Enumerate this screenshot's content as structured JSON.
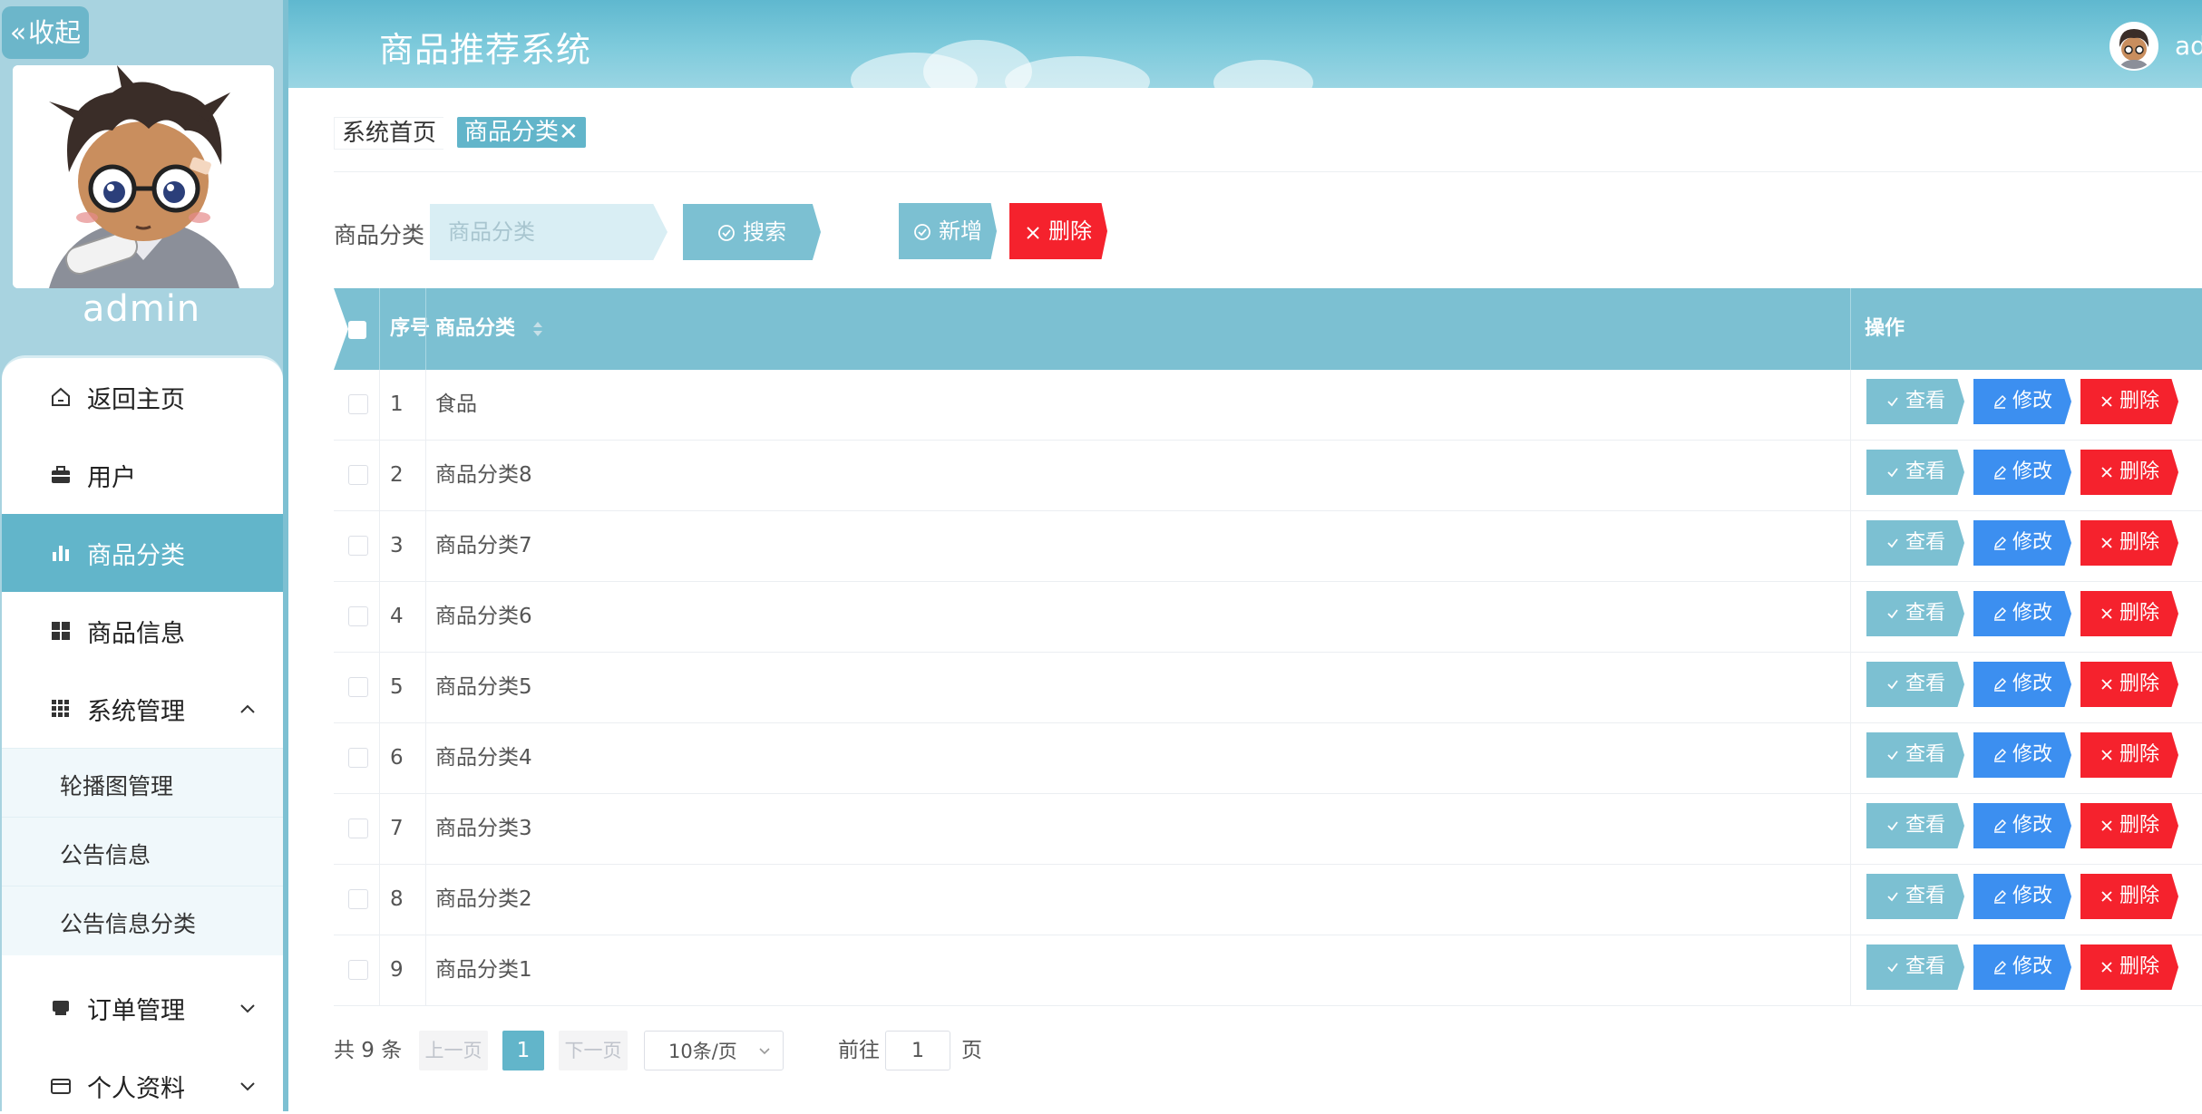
{
  "sidebar": {
    "collapse_label": "收起",
    "username": "admin",
    "menu": [
      {
        "label": "返回主页",
        "icon": "home-icon"
      },
      {
        "label": "用户",
        "icon": "briefcase-icon"
      },
      {
        "label": "商品分类",
        "icon": "bar-chart-icon",
        "active": true
      },
      {
        "label": "商品信息",
        "icon": "grid-icon"
      },
      {
        "label": "系统管理",
        "icon": "apps-icon",
        "expanded": true
      },
      {
        "label": "订单管理",
        "icon": "shop-icon"
      },
      {
        "label": "个人资料",
        "icon": "wallet-icon"
      }
    ],
    "submenu": [
      "轮播图管理",
      "公告信息",
      "公告信息分类"
    ]
  },
  "header": {
    "title": "商品推荐系统",
    "user_label": "admin"
  },
  "tabs": {
    "home": "系统首页",
    "current": "商品分类",
    "close_glyph": "✕"
  },
  "search": {
    "label": "商品分类",
    "placeholder": "商品分类",
    "search_label": "搜索",
    "add_label": "新增",
    "delete_label": "删除"
  },
  "table": {
    "columns": {
      "index": "序号",
      "category": "商品分类",
      "actions": "操作"
    },
    "rows": [
      {
        "index": "1",
        "category": "食品"
      },
      {
        "index": "2",
        "category": "商品分类8"
      },
      {
        "index": "3",
        "category": "商品分类7"
      },
      {
        "index": "4",
        "category": "商品分类6"
      },
      {
        "index": "5",
        "category": "商品分类5"
      },
      {
        "index": "6",
        "category": "商品分类4"
      },
      {
        "index": "7",
        "category": "商品分类3"
      },
      {
        "index": "8",
        "category": "商品分类2"
      },
      {
        "index": "9",
        "category": "商品分类1"
      }
    ],
    "actions": {
      "view": "查看",
      "edit": "修改",
      "delete": "删除"
    }
  },
  "pagination": {
    "total": "共 9 条",
    "prev": "上一页",
    "current_page": "1",
    "next": "下一页",
    "page_size": "10条/页",
    "goto_label": "前往",
    "goto_value": "1",
    "page_unit": "页"
  },
  "colors": {
    "accent": "#62b5ca",
    "button_teal": "#7cc0d2",
    "button_blue": "#3c8ff0",
    "button_red": "#f5222d",
    "sidebar_bg": "#a8d3e0"
  }
}
